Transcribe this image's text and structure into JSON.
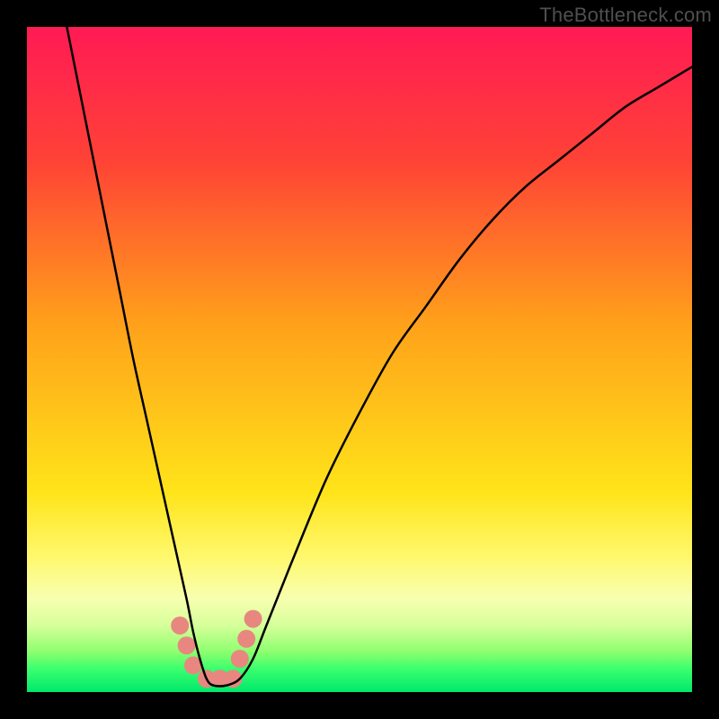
{
  "watermark": "TheBottleneck.com",
  "chart_data": {
    "type": "line",
    "title": "",
    "xlabel": "",
    "ylabel": "",
    "xlim": [
      0,
      100
    ],
    "ylim": [
      0,
      100
    ],
    "grid": false,
    "legend": false,
    "gradient_stops": [
      {
        "offset": 0,
        "color": "#ff1a55"
      },
      {
        "offset": 0.2,
        "color": "#ff4236"
      },
      {
        "offset": 0.45,
        "color": "#ffa21a"
      },
      {
        "offset": 0.7,
        "color": "#ffe41a"
      },
      {
        "offset": 0.8,
        "color": "#fff970"
      },
      {
        "offset": 0.86,
        "color": "#f7ffb0"
      },
      {
        "offset": 0.9,
        "color": "#d6ff9a"
      },
      {
        "offset": 0.94,
        "color": "#8cff6e"
      },
      {
        "offset": 0.965,
        "color": "#3bff6e"
      },
      {
        "offset": 1.0,
        "color": "#00e86b"
      }
    ],
    "series": [
      {
        "name": "curve",
        "color": "#000000",
        "stroke_width": 2.5,
        "x": [
          6,
          8,
          10,
          12,
          14,
          16,
          18,
          20,
          22,
          24,
          25,
          26,
          27,
          28,
          30,
          32,
          34,
          36,
          40,
          45,
          50,
          55,
          60,
          65,
          70,
          75,
          80,
          85,
          90,
          95,
          100
        ],
        "y": [
          100,
          90,
          80,
          70,
          60,
          50,
          41,
          32,
          23,
          14,
          9,
          5,
          2,
          1,
          1,
          2,
          5,
          10,
          20,
          32,
          42,
          51,
          58,
          65,
          71,
          76,
          80,
          84,
          88,
          91,
          94
        ]
      }
    ],
    "markers": {
      "color": "#e8877f",
      "radius": 10,
      "points": [
        {
          "x": 23,
          "y": 10
        },
        {
          "x": 24,
          "y": 7
        },
        {
          "x": 25,
          "y": 4
        },
        {
          "x": 27,
          "y": 2
        },
        {
          "x": 29,
          "y": 2
        },
        {
          "x": 31,
          "y": 2
        },
        {
          "x": 32,
          "y": 5
        },
        {
          "x": 33,
          "y": 8
        },
        {
          "x": 34,
          "y": 11
        }
      ]
    }
  }
}
